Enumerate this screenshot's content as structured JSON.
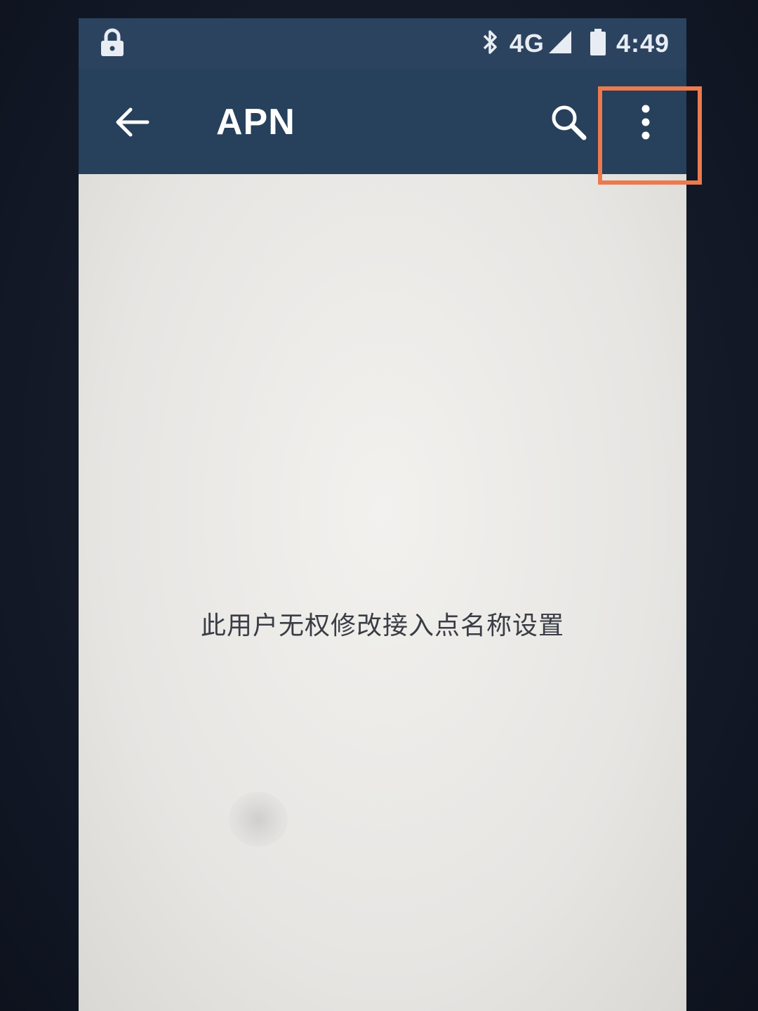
{
  "status_bar": {
    "network": "4G",
    "time": "4:49",
    "icons": [
      "lock-icon",
      "bluetooth-icon",
      "signal-icon",
      "battery-icon"
    ]
  },
  "app_bar": {
    "title": "APN",
    "icons": [
      "back-arrow-icon",
      "search-icon",
      "more-vert-icon"
    ]
  },
  "content": {
    "message": "此用户无权修改接入点名称设置"
  },
  "colors": {
    "app_bar_bg": "#27405b",
    "status_bar_bg": "#2c4360",
    "content_bg": "#e8e7e3",
    "highlight": "#ec7a4e"
  }
}
